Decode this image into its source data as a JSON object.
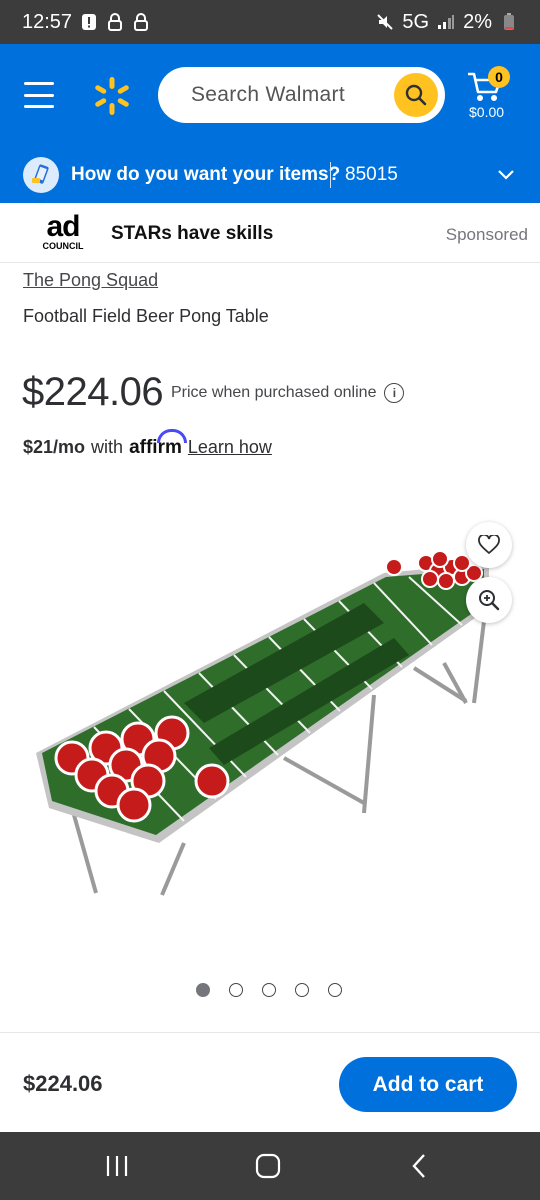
{
  "status_bar": {
    "time": "12:57",
    "network": "5G",
    "battery": "2%",
    "icons": [
      "alert-icon",
      "lock-icon",
      "lock-icon",
      "mute-icon",
      "signal-icon",
      "battery-icon"
    ]
  },
  "header": {
    "search_placeholder": "Search Walmart",
    "cart_count": "0",
    "cart_total": "$0.00",
    "brand_color": "#0071dc",
    "accent_color": "#ffc220"
  },
  "delivery": {
    "prompt": "How do you want your items?",
    "zip": "85015"
  },
  "ad": {
    "logo_text": "ad",
    "logo_sub": "COUNCIL",
    "title": "STARs have skills",
    "sponsored": "Sponsored"
  },
  "product": {
    "brand": "The Pong Squad",
    "title": "Football Field Beer Pong Table",
    "price": "$224.06",
    "price_note": "Price when purchased online",
    "affirm_monthly": "$21/mo",
    "affirm_with": "with",
    "affirm_logo": "affirm",
    "affirm_learn": "Learn how",
    "image_count": 5,
    "image_active_index": 0
  },
  "bottom_bar": {
    "price": "$224.06",
    "add_to_cart": "Add to cart"
  },
  "nav_bar": {
    "icons": [
      "recent-apps-icon",
      "home-icon",
      "back-icon"
    ]
  }
}
